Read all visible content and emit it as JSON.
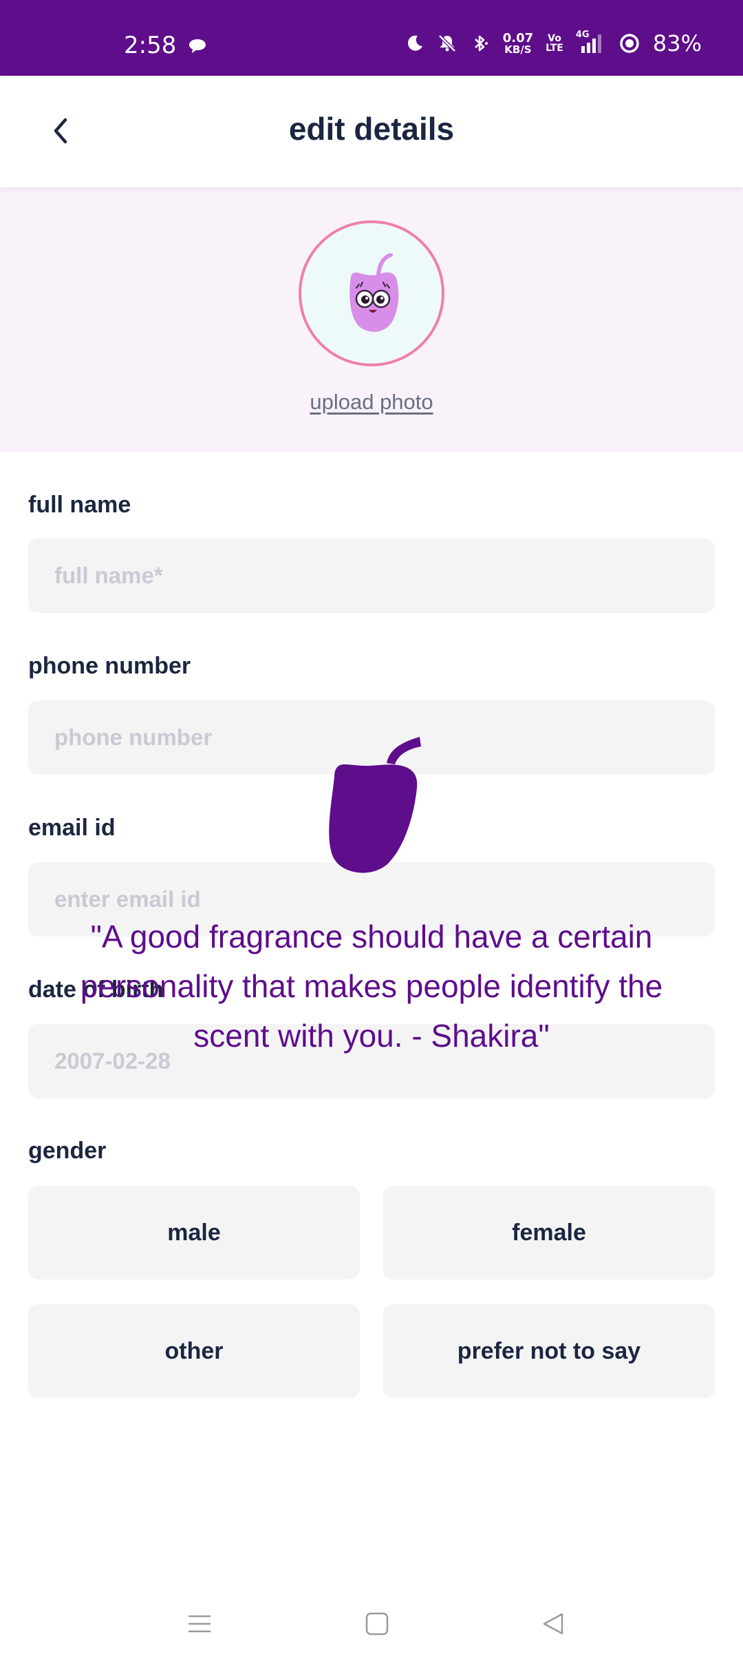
{
  "status_bar": {
    "time": "2:58",
    "net_speed_value": "0.07",
    "net_speed_unit": "KB/S",
    "volte_top": "Vo",
    "volte_bottom": "LTE",
    "network": "4G",
    "battery": "83%",
    "icons": [
      "chat-bubble-icon",
      "moon-icon",
      "bell-muted-icon",
      "bluetooth-icon",
      "signal-icon",
      "battery-icon"
    ]
  },
  "header": {
    "title": "edit details",
    "back_icon": "chevron-left-icon"
  },
  "photo": {
    "upload_label": "upload photo"
  },
  "form": {
    "full_name": {
      "label": "full name",
      "placeholder": "full name*",
      "value": ""
    },
    "phone": {
      "label": "phone number",
      "placeholder": "phone number",
      "value": ""
    },
    "email": {
      "label": "email id",
      "placeholder": "enter email id",
      "value": ""
    },
    "dob": {
      "label": "date of birth",
      "placeholder": "2007-02-28",
      "value": ""
    },
    "gender": {
      "label": "gender",
      "options": [
        "male",
        "female",
        "other",
        "prefer not to say"
      ]
    }
  },
  "overlay": {
    "quote": "\"A good fragrance should have a certain personality that makes people identify the scent with you. - Shakira\""
  },
  "nav_bar": {
    "icons": [
      "menu-icon",
      "home-icon",
      "back-triangle-icon"
    ]
  },
  "colors": {
    "brand": "#5e0d8b",
    "accent_ring": "#ef7fac",
    "field_bg": "#f4f4f5",
    "photo_bg": "#f9f2fb"
  }
}
